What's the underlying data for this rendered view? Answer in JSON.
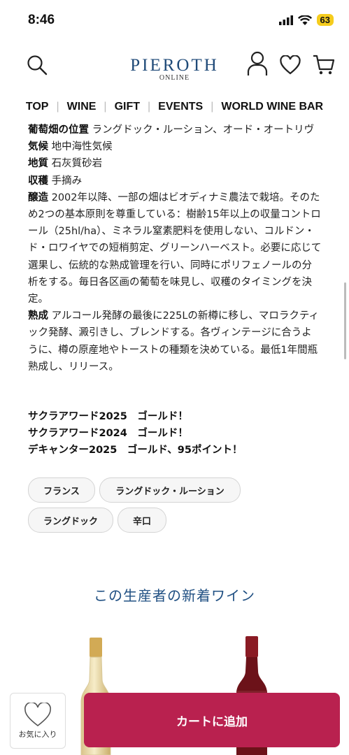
{
  "status_bar": {
    "time": "8:46",
    "battery": "63"
  },
  "header": {
    "logo_main": "PIEROTH",
    "logo_sub": "ONLINE"
  },
  "nav": [
    "TOP",
    "WINE",
    "GIFT",
    "EVENTS",
    "WORLD WINE BAR"
  ],
  "details": [
    {
      "label": "葡萄畑の位置",
      "text": " ラングドック・ルーション、オード・オートリヴ"
    },
    {
      "label": "気候",
      "text": " 地中海性気候"
    },
    {
      "label": "地質",
      "text": " 石灰質砂岩"
    },
    {
      "label": "収穫",
      "text": " 手摘み"
    },
    {
      "label": "醸造",
      "text": " 2002年以降、一部の畑はビオディナミ農法で栽培。そのため2つの基本原則を尊重している：樹齢15年以上の収量コントロール（25hl/ha）、ミネラル窒素肥料を使用しない、コルドン・ド・ロワイヤでの短梢剪定、グリーンハーベスト。必要に応じて選果し、伝統的な熟成管理を行い、同時にポリフェノールの分析をする。毎日各区画の葡萄を味見し、収穫のタイミングを決定。"
    },
    {
      "label": "熟成",
      "text": " アルコール発酵の最後に225Lの新樽に移し、マロラクティック発酵、澱引きし、ブレンドする。各ヴィンテージに合うように、樽の原産地やトーストの種類を決めている。最低1年間瓶熟成し、リリース。"
    }
  ],
  "awards": [
    "サクラアワード2025　ゴールド！",
    "サクラアワード2024　ゴールド！",
    "デキャンター2025　ゴールド、95ポイント！"
  ],
  "tags": [
    "フランス",
    "ラングドック・ルーション",
    "ラングドック",
    "辛口"
  ],
  "section_title": "この生産者の新着ワイン",
  "bottom": {
    "favorite_label": "お気に入り",
    "cart_label": "カートに追加"
  },
  "colors": {
    "accent": "#b9214f",
    "brand": "#1f4a78"
  }
}
